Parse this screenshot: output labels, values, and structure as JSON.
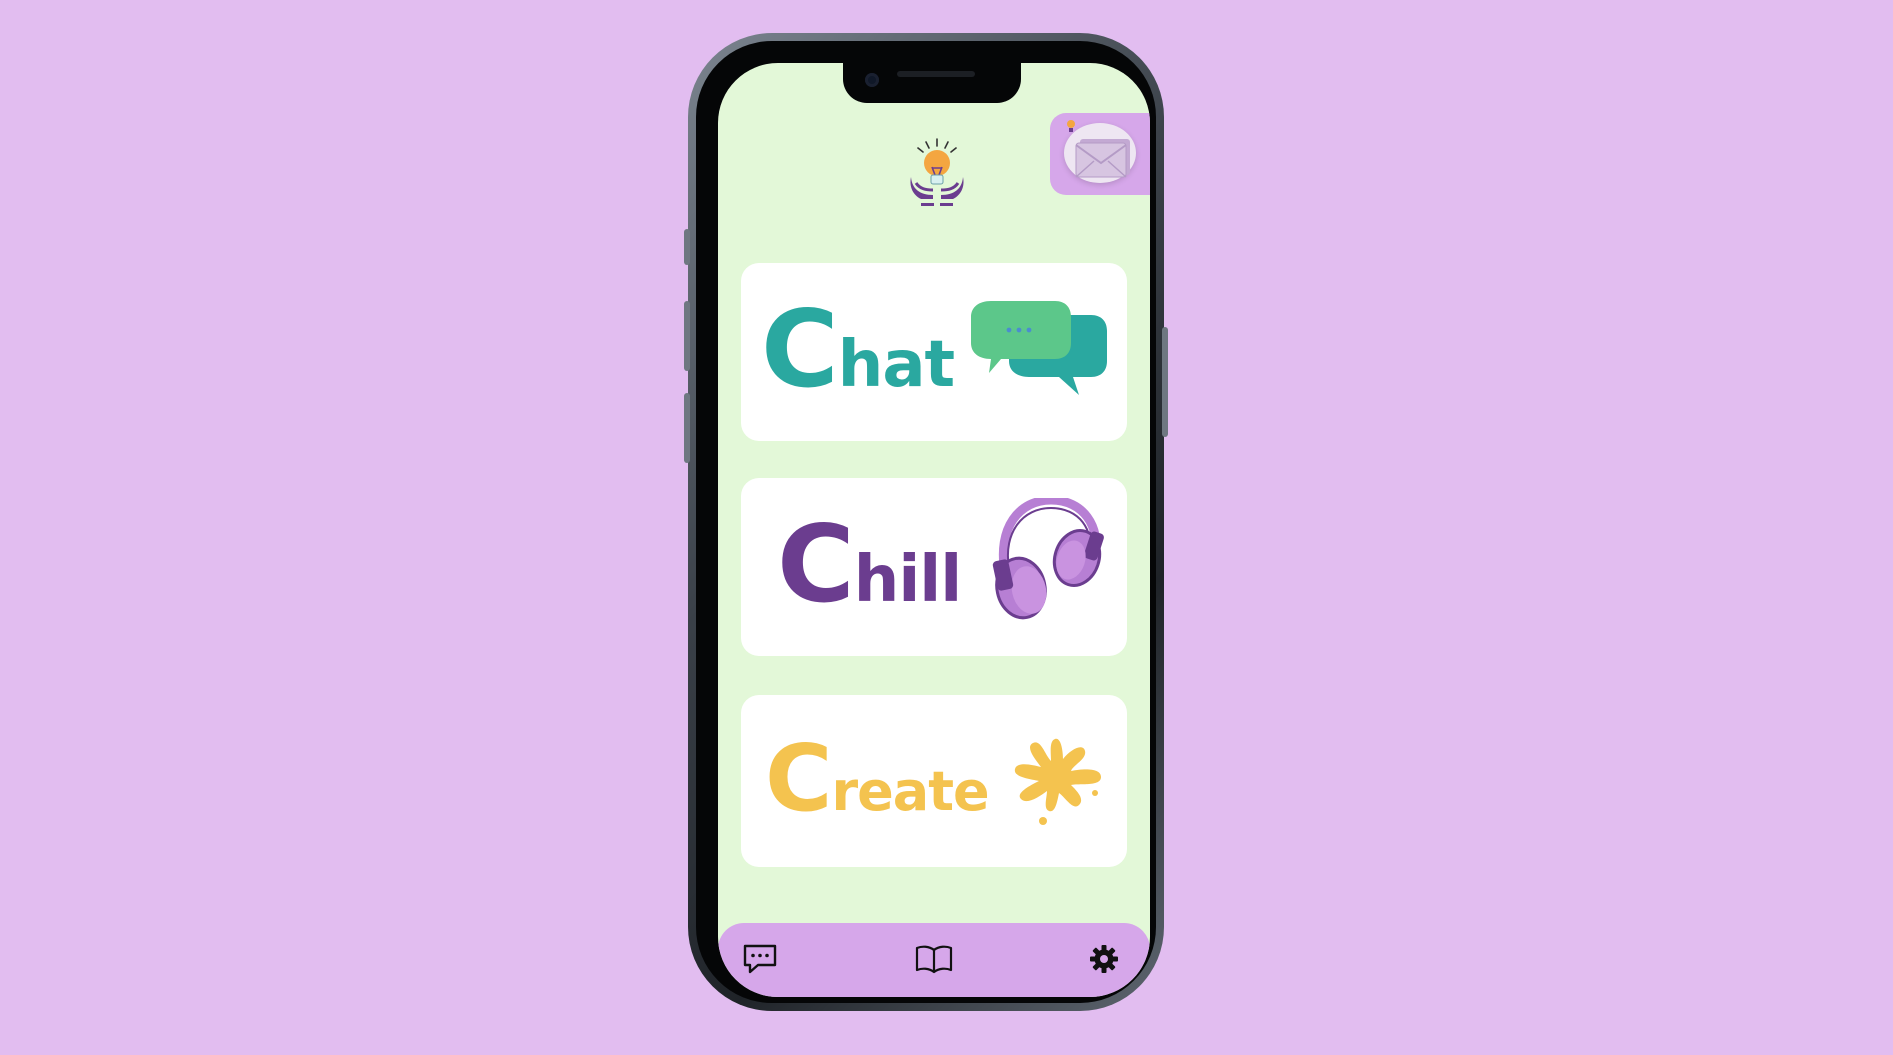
{
  "background_color": "#e2bdf0",
  "screen_color": "#e3f8d8",
  "header": {
    "logo_icon": "lightbulb-in-hands-icon",
    "mail_icon": "envelope-icon"
  },
  "cards": {
    "chat": {
      "initial": "C",
      "rest": "hat",
      "color": "#2aa8a0",
      "icon": "speech-bubbles-icon"
    },
    "chill": {
      "initial": "C",
      "rest": "hill",
      "color": "#6b3d8f",
      "icon": "headphones-icon"
    },
    "create": {
      "initial": "C",
      "rest": "reate",
      "color": "#f4c34f",
      "icon": "paint-splash-icon"
    }
  },
  "tabbar": {
    "color": "#d6a7ea",
    "items": [
      {
        "icon": "chat-bubble-icon"
      },
      {
        "icon": "book-icon"
      },
      {
        "icon": "gear-icon"
      }
    ]
  }
}
